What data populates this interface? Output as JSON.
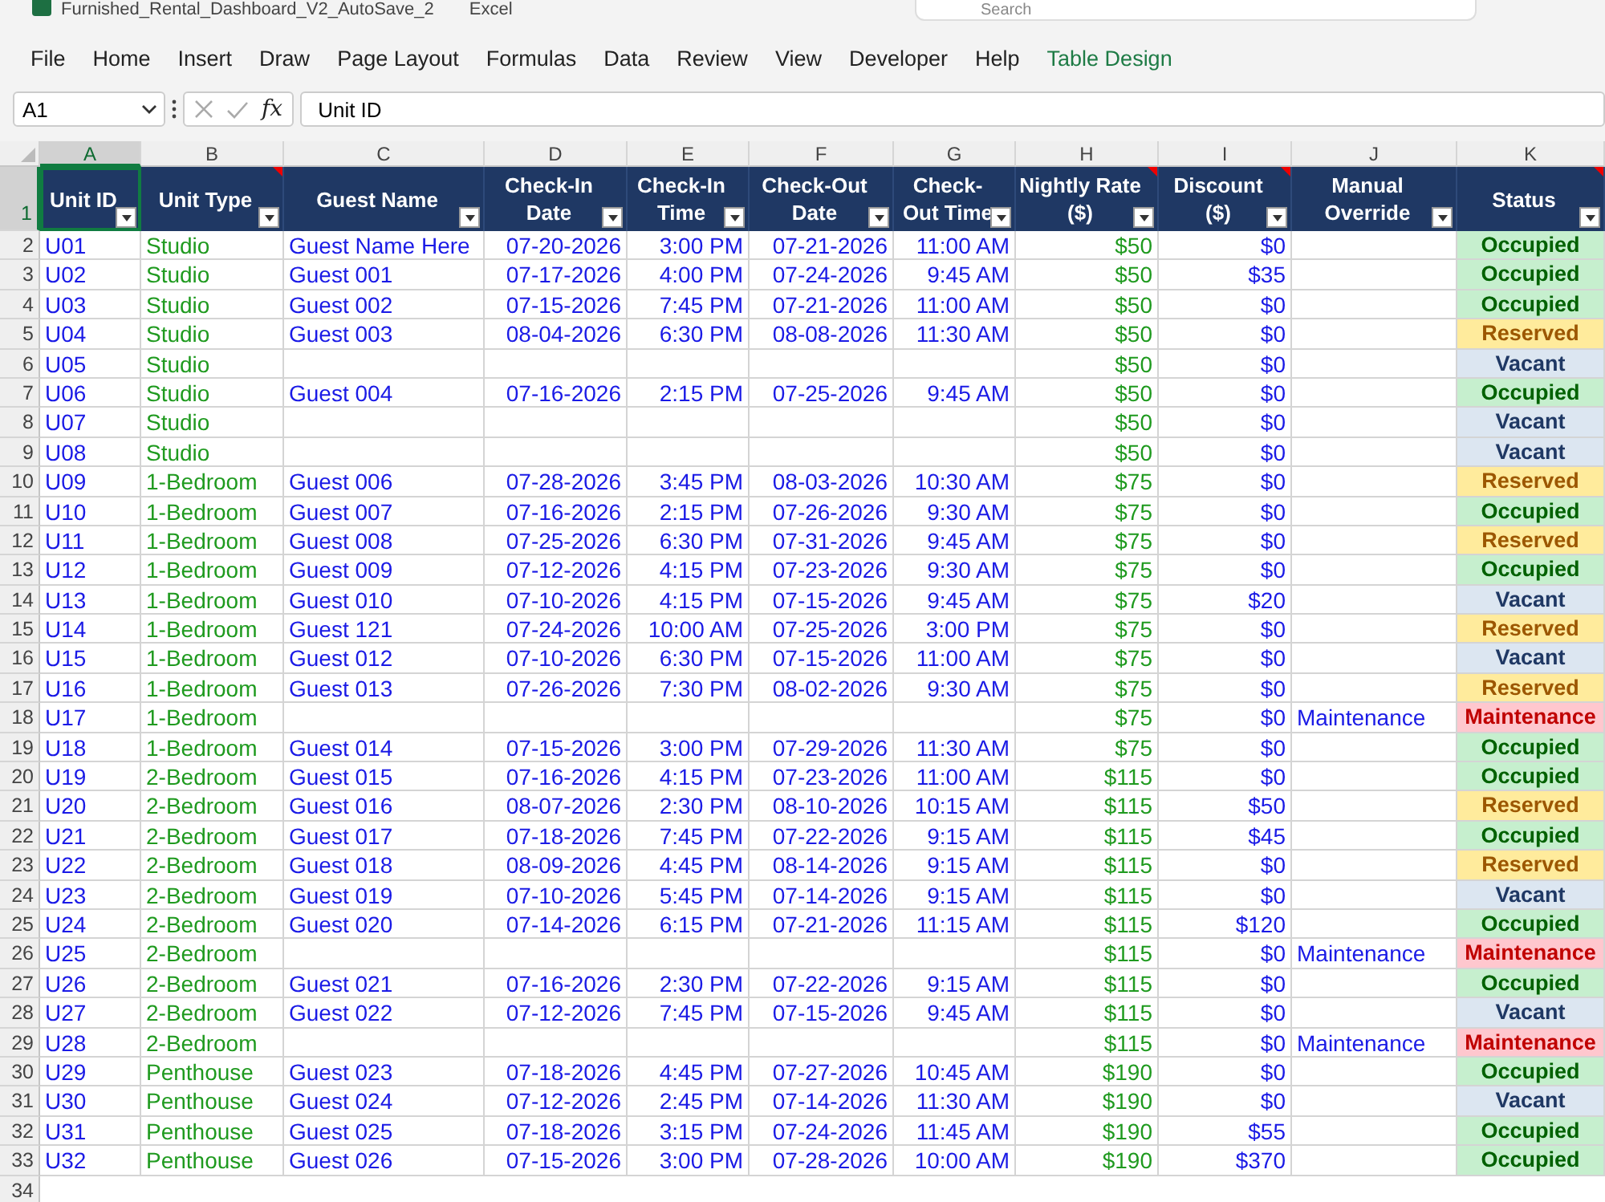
{
  "window": {
    "title": "Furnished_Rental_Dashboard_V2_AutoSave_2",
    "app": "Excel",
    "search": {
      "placeholder": "Search"
    }
  },
  "menu": [
    {
      "label": "File",
      "kind": "normal"
    },
    {
      "label": "Home",
      "kind": "normal"
    },
    {
      "label": "Insert",
      "kind": "normal"
    },
    {
      "label": "Draw",
      "kind": "normal"
    },
    {
      "label": "Page Layout",
      "kind": "normal"
    },
    {
      "label": "Formulas",
      "kind": "normal"
    },
    {
      "label": "Data",
      "kind": "normal"
    },
    {
      "label": "Review",
      "kind": "normal"
    },
    {
      "label": "View",
      "kind": "normal"
    },
    {
      "label": "Developer",
      "kind": "normal"
    },
    {
      "label": "Help",
      "kind": "normal"
    },
    {
      "label": "Table Design",
      "kind": "contextual"
    }
  ],
  "formula_bar": {
    "name_box": "A1",
    "function_label": "fx",
    "formula": "Unit ID"
  },
  "sheet": {
    "header_row_number": "1",
    "empty_rows": [
      "34"
    ],
    "columns": [
      {
        "letter": "A",
        "title": "Unit ID",
        "selected": true,
        "note": false
      },
      {
        "letter": "B",
        "title": "Unit Type",
        "selected": false,
        "note": true
      },
      {
        "letter": "C",
        "title": "Guest Name",
        "selected": false,
        "note": false
      },
      {
        "letter": "D",
        "title": "Check-In Date",
        "selected": false,
        "note": false
      },
      {
        "letter": "E",
        "title": "Check-In Time",
        "selected": false,
        "note": false
      },
      {
        "letter": "F",
        "title": "Check-Out Date",
        "selected": false,
        "note": false
      },
      {
        "letter": "G",
        "title": "Check-Out Time",
        "selected": false,
        "note": false
      },
      {
        "letter": "H",
        "title": "Nightly Rate ($)",
        "selected": false,
        "note": true
      },
      {
        "letter": "I",
        "title": "Discount ($)",
        "selected": false,
        "note": true
      },
      {
        "letter": "J",
        "title": "Manual Override",
        "selected": false,
        "note": false
      },
      {
        "letter": "K",
        "title": "Status",
        "selected": false,
        "note": true
      }
    ],
    "rows": [
      {
        "row_number": "2",
        "unit": "U01",
        "type": "Studio",
        "guest": "Guest Name Here",
        "check_in_date": "07-20-2026",
        "check_in_time": "3:00 PM",
        "check_out_date": "07-21-2026",
        "check_out_time": "11:00 AM",
        "rate": "$50",
        "discount": "$0",
        "status": "Occupied",
        "color": "#c6efce"
      },
      {
        "row_number": "3",
        "unit": "U02",
        "type": "Studio",
        "guest": "Guest 001",
        "check_in_date": "07-17-2026",
        "check_in_time": "4:00 PM",
        "check_out_date": "07-24-2026",
        "check_out_time": "9:45 AM",
        "rate": "$50",
        "discount": "$35",
        "status": "Occupied",
        "color": "#c6efce"
      },
      {
        "row_number": "4",
        "unit": "U03",
        "type": "Studio",
        "guest": "Guest 002",
        "check_in_date": "07-15-2026",
        "check_in_time": "7:45 PM",
        "check_out_date": "07-21-2026",
        "check_out_time": "11:00 AM",
        "rate": "$50",
        "discount": "$0",
        "status": "Occupied",
        "color": "#c6efce"
      },
      {
        "row_number": "5",
        "unit": "U04",
        "type": "Studio",
        "guest": "Guest 003",
        "check_in_date": "08-04-2026",
        "check_in_time": "6:30 PM",
        "check_out_date": "08-08-2026",
        "check_out_time": "11:30 AM",
        "rate": "$50",
        "discount": "$0",
        "status": "Reserved",
        "color": "#ffeb9c"
      },
      {
        "row_number": "6",
        "unit": "U05",
        "type": "Studio",
        "rate": "$50",
        "discount": "$0",
        "status": "Vacant",
        "color": "#dce6f1"
      },
      {
        "row_number": "7",
        "unit": "U06",
        "type": "Studio",
        "guest": "Guest 004",
        "check_in_date": "07-16-2026",
        "check_in_time": "2:15 PM",
        "check_out_date": "07-25-2026",
        "check_out_time": "9:45 AM",
        "rate": "$50",
        "discount": "$0",
        "status": "Occupied",
        "color": "#c6efce"
      },
      {
        "row_number": "8",
        "unit": "U07",
        "type": "Studio",
        "rate": "$50",
        "discount": "$0",
        "status": "Vacant",
        "color": "#dce6f1"
      },
      {
        "row_number": "9",
        "unit": "U08",
        "type": "Studio",
        "rate": "$50",
        "discount": "$0",
        "status": "Vacant",
        "color": "#dce6f1"
      },
      {
        "row_number": "10",
        "unit": "U09",
        "type": "1-Bedroom",
        "guest": "Guest 006",
        "check_in_date": "07-28-2026",
        "check_in_time": "3:45 PM",
        "check_out_date": "08-03-2026",
        "check_out_time": "10:30 AM",
        "rate": "$75",
        "discount": "$0",
        "status": "Reserved",
        "color": "#ffeb9c"
      },
      {
        "row_number": "11",
        "unit": "U10",
        "type": "1-Bedroom",
        "guest": "Guest 007",
        "check_in_date": "07-16-2026",
        "check_in_time": "2:15 PM",
        "check_out_date": "07-26-2026",
        "check_out_time": "9:30 AM",
        "rate": "$75",
        "discount": "$0",
        "status": "Occupied",
        "color": "#c6efce"
      },
      {
        "row_number": "12",
        "unit": "U11",
        "type": "1-Bedroom",
        "guest": "Guest 008",
        "check_in_date": "07-25-2026",
        "check_in_time": "6:30 PM",
        "check_out_date": "07-31-2026",
        "check_out_time": "9:45 AM",
        "rate": "$75",
        "discount": "$0",
        "status": "Reserved",
        "color": "#ffeb9c"
      },
      {
        "row_number": "13",
        "unit": "U12",
        "type": "1-Bedroom",
        "guest": "Guest 009",
        "check_in_date": "07-12-2026",
        "check_in_time": "4:15 PM",
        "check_out_date": "07-23-2026",
        "check_out_time": "9:30 AM",
        "rate": "$75",
        "discount": "$0",
        "status": "Occupied",
        "color": "#c6efce"
      },
      {
        "row_number": "14",
        "unit": "U13",
        "type": "1-Bedroom",
        "guest": "Guest 010",
        "check_in_date": "07-10-2026",
        "check_in_time": "4:15 PM",
        "check_out_date": "07-15-2026",
        "check_out_time": "9:45 AM",
        "rate": "$75",
        "discount": "$20",
        "status": "Vacant",
        "color": "#dce6f1"
      },
      {
        "row_number": "15",
        "unit": "U14",
        "type": "1-Bedroom",
        "guest": "Guest 121",
        "check_in_date": "07-24-2026",
        "check_in_time": "10:00 AM",
        "check_out_date": "07-25-2026",
        "check_out_time": "3:00 PM",
        "rate": "$75",
        "discount": "$0",
        "status": "Reserved",
        "color": "#ffeb9c"
      },
      {
        "row_number": "16",
        "unit": "U15",
        "type": "1-Bedroom",
        "guest": "Guest 012",
        "check_in_date": "07-10-2026",
        "check_in_time": "6:30 PM",
        "check_out_date": "07-15-2026",
        "check_out_time": "11:00 AM",
        "rate": "$75",
        "discount": "$0",
        "status": "Vacant",
        "color": "#dce6f1"
      },
      {
        "row_number": "17",
        "unit": "U16",
        "type": "1-Bedroom",
        "guest": "Guest 013",
        "check_in_date": "07-26-2026",
        "check_in_time": "7:30 PM",
        "check_out_date": "08-02-2026",
        "check_out_time": "9:30 AM",
        "rate": "$75",
        "discount": "$0",
        "status": "Reserved",
        "color": "#ffeb9c"
      },
      {
        "row_number": "18",
        "unit": "U17",
        "type": "1-Bedroom",
        "rate": "$75",
        "discount": "$0",
        "override": "Maintenance",
        "status": "Maintenance",
        "color": "#ffc7ce"
      },
      {
        "row_number": "19",
        "unit": "U18",
        "type": "1-Bedroom",
        "guest": "Guest 014",
        "check_in_date": "07-15-2026",
        "check_in_time": "3:00 PM",
        "check_out_date": "07-29-2026",
        "check_out_time": "11:30 AM",
        "rate": "$75",
        "discount": "$0",
        "status": "Occupied",
        "color": "#c6efce"
      },
      {
        "row_number": "20",
        "unit": "U19",
        "type": "2-Bedroom",
        "guest": "Guest 015",
        "check_in_date": "07-16-2026",
        "check_in_time": "4:15 PM",
        "check_out_date": "07-23-2026",
        "check_out_time": "11:00 AM",
        "rate": "$115",
        "discount": "$0",
        "status": "Occupied",
        "color": "#c6efce"
      },
      {
        "row_number": "21",
        "unit": "U20",
        "type": "2-Bedroom",
        "guest": "Guest 016",
        "check_in_date": "08-07-2026",
        "check_in_time": "2:30 PM",
        "check_out_date": "08-10-2026",
        "check_out_time": "10:15 AM",
        "rate": "$115",
        "discount": "$50",
        "status": "Reserved",
        "color": "#ffeb9c"
      },
      {
        "row_number": "22",
        "unit": "U21",
        "type": "2-Bedroom",
        "guest": "Guest 017",
        "check_in_date": "07-18-2026",
        "check_in_time": "7:45 PM",
        "check_out_date": "07-22-2026",
        "check_out_time": "9:15 AM",
        "rate": "$115",
        "discount": "$45",
        "status": "Occupied",
        "color": "#c6efce"
      },
      {
        "row_number": "23",
        "unit": "U22",
        "type": "2-Bedroom",
        "guest": "Guest 018",
        "check_in_date": "08-09-2026",
        "check_in_time": "4:45 PM",
        "check_out_date": "08-14-2026",
        "check_out_time": "9:15 AM",
        "rate": "$115",
        "discount": "$0",
        "status": "Reserved",
        "color": "#ffeb9c"
      },
      {
        "row_number": "24",
        "unit": "U23",
        "type": "2-Bedroom",
        "guest": "Guest 019",
        "check_in_date": "07-10-2026",
        "check_in_time": "5:45 PM",
        "check_out_date": "07-14-2026",
        "check_out_time": "9:15 AM",
        "rate": "$115",
        "discount": "$0",
        "status": "Vacant",
        "color": "#dce6f1"
      },
      {
        "row_number": "25",
        "unit": "U24",
        "type": "2-Bedroom",
        "guest": "Guest 020",
        "check_in_date": "07-14-2026",
        "check_in_time": "6:15 PM",
        "check_out_date": "07-21-2026",
        "check_out_time": "11:15 AM",
        "rate": "$115",
        "discount": "$120",
        "status": "Occupied",
        "color": "#c6efce"
      },
      {
        "row_number": "26",
        "unit": "U25",
        "type": "2-Bedroom",
        "rate": "$115",
        "discount": "$0",
        "override": "Maintenance",
        "status": "Maintenance",
        "color": "#ffc7ce"
      },
      {
        "row_number": "27",
        "unit": "U26",
        "type": "2-Bedroom",
        "guest": "Guest 021",
        "check_in_date": "07-16-2026",
        "check_in_time": "2:30 PM",
        "check_out_date": "07-22-2026",
        "check_out_time": "9:15 AM",
        "rate": "$115",
        "discount": "$0",
        "status": "Occupied",
        "color": "#c6efce"
      },
      {
        "row_number": "28",
        "unit": "U27",
        "type": "2-Bedroom",
        "guest": "Guest 022",
        "check_in_date": "07-12-2026",
        "check_in_time": "7:45 PM",
        "check_out_date": "07-15-2026",
        "check_out_time": "9:45 AM",
        "rate": "$115",
        "discount": "$0",
        "status": "Vacant",
        "color": "#dce6f1"
      },
      {
        "row_number": "29",
        "unit": "U28",
        "type": "2-Bedroom",
        "rate": "$115",
        "discount": "$0",
        "override": "Maintenance",
        "status": "Maintenance",
        "color": "#ffc7ce"
      },
      {
        "row_number": "30",
        "unit": "U29",
        "type": "Penthouse",
        "guest": "Guest 023",
        "check_in_date": "07-18-2026",
        "check_in_time": "4:45 PM",
        "check_out_date": "07-27-2026",
        "check_out_time": "10:45 AM",
        "rate": "$190",
        "discount": "$0",
        "status": "Occupied",
        "color": "#c6efce"
      },
      {
        "row_number": "31",
        "unit": "U30",
        "type": "Penthouse",
        "guest": "Guest 024",
        "check_in_date": "07-12-2026",
        "check_in_time": "2:45 PM",
        "check_out_date": "07-14-2026",
        "check_out_time": "11:30 AM",
        "rate": "$190",
        "discount": "$0",
        "status": "Vacant",
        "color": "#dce6f1"
      },
      {
        "row_number": "32",
        "unit": "U31",
        "type": "Penthouse",
        "guest": "Guest 025",
        "check_in_date": "07-18-2026",
        "check_in_time": "3:15 PM",
        "check_out_date": "07-24-2026",
        "check_out_time": "11:45 AM",
        "rate": "$190",
        "discount": "$55",
        "status": "Occupied",
        "color": "#c6efce"
      },
      {
        "row_number": "33",
        "unit": "U32",
        "type": "Penthouse",
        "guest": "Guest 026",
        "check_in_date": "07-15-2026",
        "check_in_time": "3:00 PM",
        "check_out_date": "07-28-2026",
        "check_out_time": "10:00 AM",
        "rate": "$190",
        "discount": "$370",
        "status": "Occupied",
        "color": "#c6efce"
      }
    ]
  }
}
